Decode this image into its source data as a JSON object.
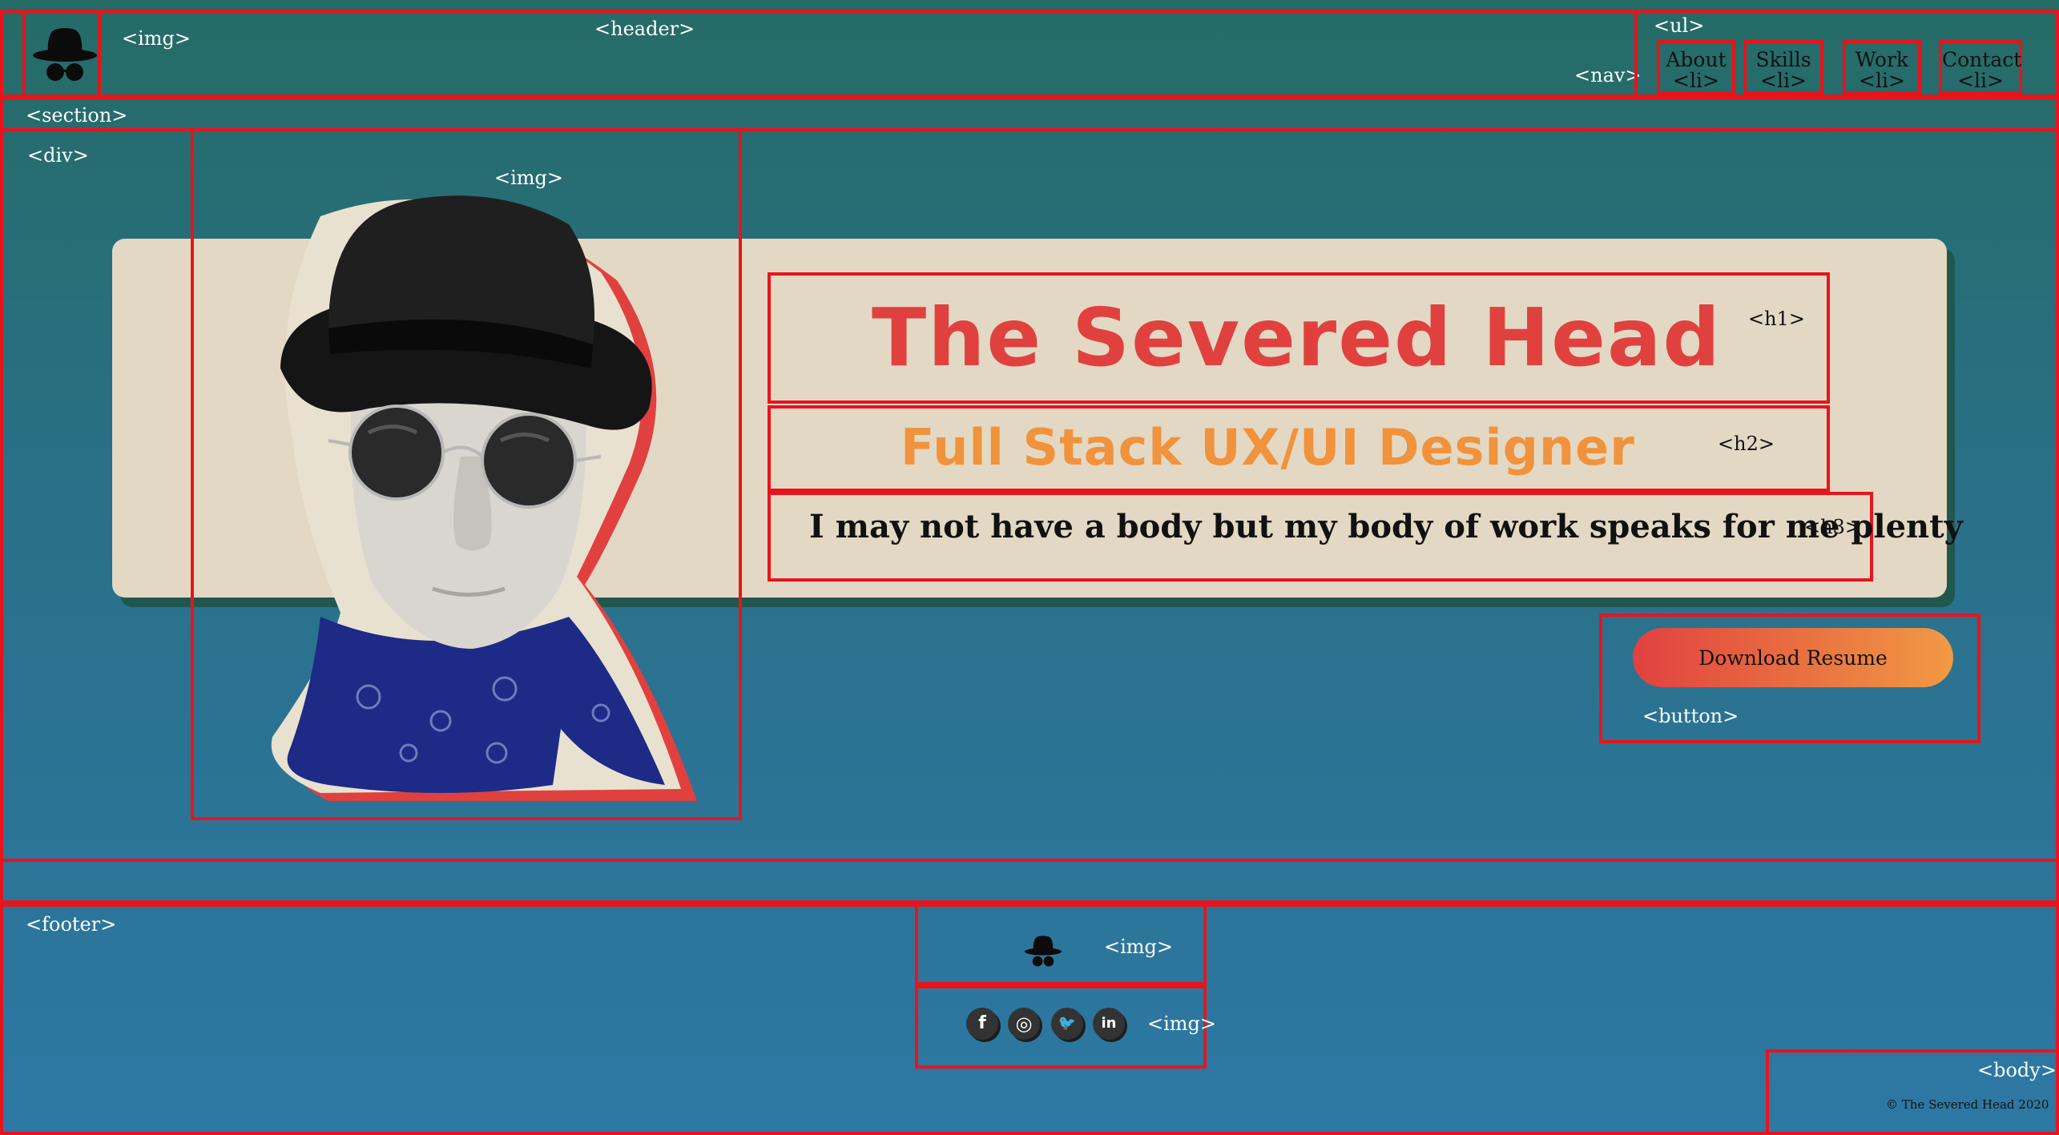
{
  "tags": {
    "header": "<header>",
    "logo_img": "<img>",
    "nav": "<nav>",
    "ul": "<ul>",
    "li": "<li>",
    "section": "<section>",
    "div": "<div>",
    "hero_img": "<img>",
    "h1": "<h1>",
    "h2": "<h2>",
    "h3": "<h3>",
    "button": "<button>",
    "footer": "<footer>",
    "footer_logo_img": "<img>",
    "social_img": "<img>",
    "body": "<body>"
  },
  "nav": {
    "items": [
      {
        "label": "About"
      },
      {
        "label": "Skills"
      },
      {
        "label": "Work"
      },
      {
        "label": "Contact"
      }
    ]
  },
  "hero": {
    "title": "The Severed Head",
    "subtitle": "Full Stack UX/UI Designer",
    "tagline": "I may not have a body but my body of work speaks for me plenty",
    "button_label": "Download Resume"
  },
  "footer": {
    "social": [
      {
        "icon": "facebook-icon",
        "glyph": "f"
      },
      {
        "icon": "instagram-icon",
        "glyph": "◎"
      },
      {
        "icon": "twitter-icon",
        "glyph": "🐦"
      },
      {
        "icon": "linkedin-icon",
        "glyph": "in"
      }
    ],
    "copyright": "© The Severed Head 2020"
  },
  "colors": {
    "outline": "#e8141c",
    "card": "#e3d8c4",
    "title": "#e0413f",
    "subtitle": "#f0933c",
    "bg_top": "#256b66",
    "bg_bottom": "#2d78a4"
  }
}
